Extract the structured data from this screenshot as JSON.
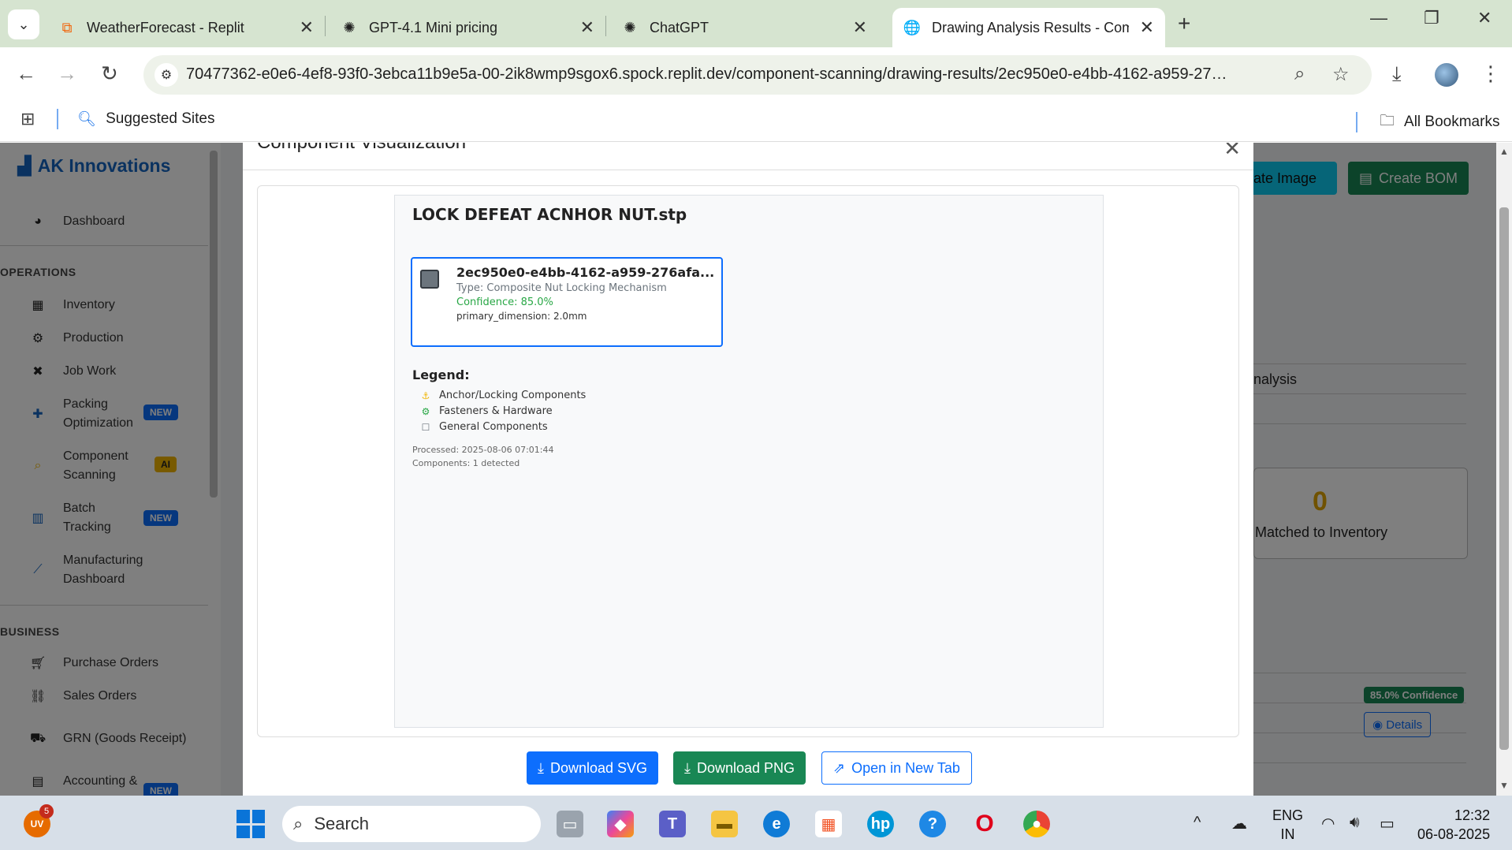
{
  "browser": {
    "tabs": [
      {
        "title": "WeatherForecast - Replit",
        "icon": "replit-icon"
      },
      {
        "title": "GPT-4.1 Mini pricing",
        "icon": "openai-icon"
      },
      {
        "title": "ChatGPT",
        "icon": "openai-icon"
      },
      {
        "title": "Drawing Analysis Results - Com",
        "icon": "globe-icon"
      }
    ],
    "url": "70477362-e0e6-4ef8-93f0-3ebca11b9e5a-00-2ik8wmp9sgox6.spock.replit.dev/component-scanning/drawing-results/2ec950e0-e4bb-4162-a959-27…",
    "bookmarks": {
      "suggested": "Suggested Sites",
      "all": "All Bookmarks"
    }
  },
  "sidebar": {
    "brand": "AK Innovations",
    "items": [
      {
        "label": "Dashboard",
        "icon": "palette-icon"
      },
      {
        "label": "Inventory",
        "icon": "boxes-icon"
      },
      {
        "label": "Production",
        "icon": "cogs-icon"
      },
      {
        "label": "Job Work",
        "icon": "tools-icon"
      },
      {
        "label": "Packing\nOptimization",
        "icon": "puzzle-icon",
        "badge": "NEW"
      },
      {
        "label": "Component\nScanning",
        "icon": "search-icon",
        "badge": "AI"
      },
      {
        "label": "Batch\nTracking",
        "icon": "barcode-icon",
        "badge": "NEW"
      },
      {
        "label": "Manufacturing\nDashboard",
        "icon": "chart-line-icon"
      },
      {
        "label": "Purchase Orders",
        "icon": "cart-icon"
      },
      {
        "label": "Sales Orders",
        "icon": "handshake-icon"
      },
      {
        "label": "GRN (Goods Receipt)",
        "icon": "truck-icon"
      },
      {
        "label": "Accounting &",
        "icon": "calculator-icon",
        "badge": "NEW"
      }
    ],
    "sections": {
      "operations": "OPERATIONS",
      "business": "BUSINESS"
    }
  },
  "background": {
    "generate_image": "erate Image",
    "create_bom": "Create BOM",
    "analysis_tab": "nalysis",
    "matched_count": "0",
    "matched_label": "Matched to Inventory",
    "confidence_badge": "85.0% Confidence",
    "details": "Details"
  },
  "modal": {
    "title": "Component Visualization",
    "drawing_title": "LOCK DEFEAT ACNHOR NUT.stp",
    "component": {
      "id": "2ec950e0-e4bb-4162-a959-276afa...",
      "type": "Type: Composite Nut Locking Mechanism",
      "confidence": "Confidence: 85.0%",
      "dimension": "primary_dimension: 2.0mm"
    },
    "legend": {
      "title": "Legend:",
      "items": [
        {
          "label": "Anchor/Locking Components",
          "icon": "anchor-icon",
          "color": "#f0b400"
        },
        {
          "label": "Fasteners & Hardware",
          "icon": "gear-icon",
          "color": "#28a745"
        },
        {
          "label": "General Components",
          "icon": "square-icon",
          "color": "#6c757d"
        }
      ]
    },
    "processed": "Processed: 2025-08-06 07:01:44",
    "components_count": "Components: 1 detected",
    "buttons": {
      "download_svg": "Download SVG",
      "download_png": "Download PNG",
      "open_new_tab": "Open in New Tab"
    }
  },
  "taskbar": {
    "user_initials": "UV",
    "notification_count": "5",
    "search": "Search",
    "lang_top": "ENG",
    "lang_bottom": "IN",
    "time": "12:32",
    "date": "06-08-2025"
  },
  "colors": {
    "primary": "#0d6efd",
    "success": "#198754",
    "brand": "#1565c0",
    "confidence_text": "#28a745"
  }
}
